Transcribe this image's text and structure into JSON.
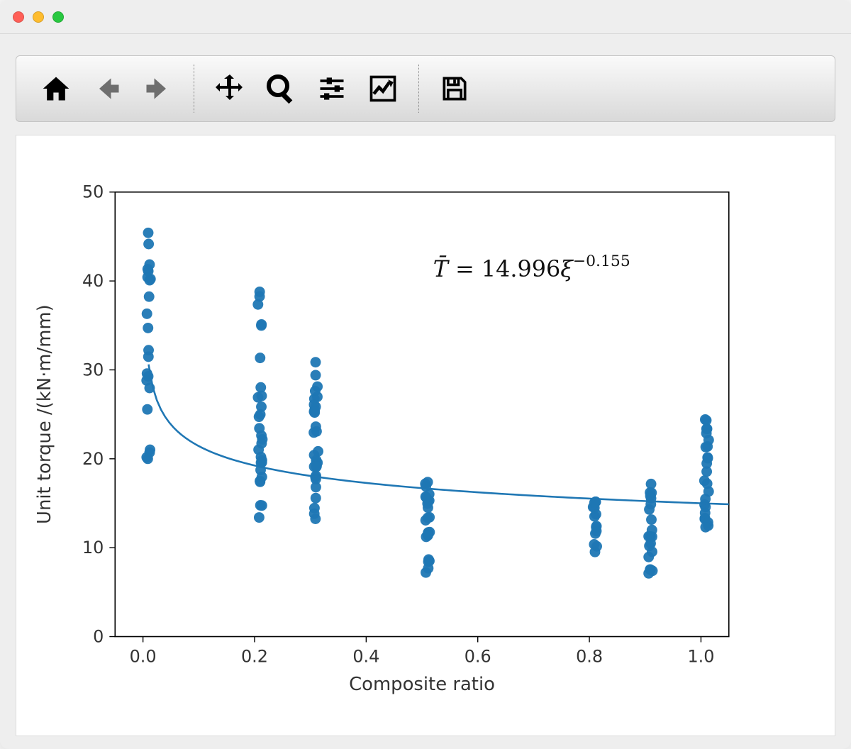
{
  "window": {
    "title": ""
  },
  "toolbar": {
    "home": {
      "name": "home-icon",
      "tip": "Reset original view"
    },
    "back": {
      "name": "back-icon",
      "tip": "Back to previous view"
    },
    "forward": {
      "name": "forward-icon",
      "tip": "Forward to next view"
    },
    "pan": {
      "name": "pan-icon",
      "tip": "Pan axes"
    },
    "zoom": {
      "name": "zoom-icon",
      "tip": "Zoom to rectangle"
    },
    "subplots": {
      "name": "subplots-icon",
      "tip": "Configure subplots"
    },
    "axes": {
      "name": "axes-icon",
      "tip": "Edit axis"
    },
    "save": {
      "name": "save-icon",
      "tip": "Save the figure"
    }
  },
  "chart_data": {
    "type": "scatter",
    "xlabel": "Composite ratio",
    "ylabel": "Unit torque /(kN·m/mm)",
    "xlim": [
      -0.05,
      1.05
    ],
    "ylim": [
      0,
      50
    ],
    "xticks": [
      0.0,
      0.2,
      0.4,
      0.6,
      0.8,
      1.0
    ],
    "yticks": [
      0,
      10,
      20,
      30,
      40,
      50
    ],
    "annotation": "T̄ = 14.996 ξ⁻⁰·¹⁵⁵",
    "fit": {
      "form": "power",
      "a": 14.996,
      "b": -0.155
    },
    "series": [
      {
        "name": "fit-curve",
        "type": "line",
        "color": "#1f77b4",
        "x_from": 0.01,
        "x_to": 1.05,
        "samples": 140
      }
    ],
    "scatter_groups": [
      {
        "x": 0.01,
        "count": 22,
        "y_min": 20.0,
        "y_max": 47.0
      },
      {
        "x": 0.21,
        "count": 28,
        "y_min": 12.3,
        "y_max": 39.0
      },
      {
        "x": 0.31,
        "count": 30,
        "y_min": 13.0,
        "y_max": 31.0
      },
      {
        "x": 0.51,
        "count": 24,
        "y_min": 7.0,
        "y_max": 17.5
      },
      {
        "x": 0.81,
        "count": 14,
        "y_min": 9.5,
        "y_max": 16.3
      },
      {
        "x": 0.91,
        "count": 20,
        "y_min": 7.0,
        "y_max": 17.5
      },
      {
        "x": 1.01,
        "count": 24,
        "y_min": 7.3,
        "y_max": 25.0
      }
    ],
    "colors": {
      "marker": "#1f77b4",
      "line": "#1f77b4",
      "axis": "#000000"
    }
  }
}
